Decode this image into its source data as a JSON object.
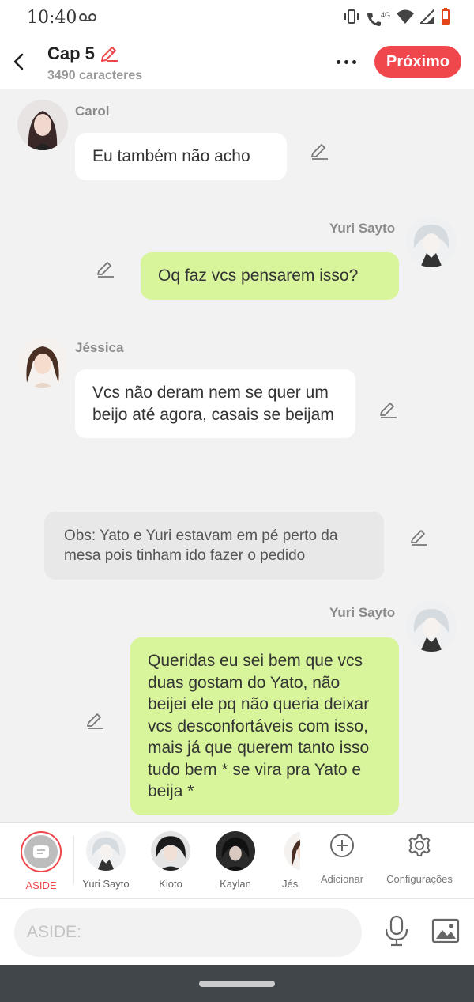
{
  "status_bar": {
    "time": "10:40",
    "network_label": "4G",
    "icons": [
      "voicemail-icon",
      "vibrate-icon",
      "wifi-calling-icon",
      "wifi-icon",
      "signal-icon",
      "battery-low-icon"
    ]
  },
  "header": {
    "title": "Cap 5",
    "char_count": "3490 caracteres",
    "next_label": "Próximo"
  },
  "colors": {
    "accent": "#f0474d",
    "bubble_right": "#d8f59c",
    "bubble_left": "#ffffff",
    "note_bg": "#e8e8e8",
    "background": "#f2f2f2"
  },
  "messages": [
    {
      "side": "left",
      "sender": "Carol",
      "text": "Eu também não acho"
    },
    {
      "side": "right",
      "sender": "Yuri Sayto",
      "text": "Oq faz vcs pensarem isso?"
    },
    {
      "side": "left",
      "sender": "Jéssica",
      "text": "Vcs não deram nem se quer um beijo até agora, casais se beijam"
    },
    {
      "side": "note",
      "sender": "",
      "text": "Obs: Yato e Yuri estavam em pé perto da mesa pois tinham ido fazer o pedido"
    },
    {
      "side": "right",
      "sender": "Yuri Sayto",
      "text": "Queridas eu sei bem que vcs duas gostam do Yato, não beijei ele pq não queria deixar vcs desconfortáveis com isso, mais já que querem tanto isso tudo bem * se vira pra Yato e beija *"
    }
  ],
  "character_bar": {
    "aside": "ASIDE",
    "characters": [
      "Yuri Sayto",
      "Kioto",
      "Kaylan",
      "Jés"
    ],
    "add_label": "Adicionar",
    "settings_label": "Configurações"
  },
  "input": {
    "placeholder": "ASIDE:"
  }
}
